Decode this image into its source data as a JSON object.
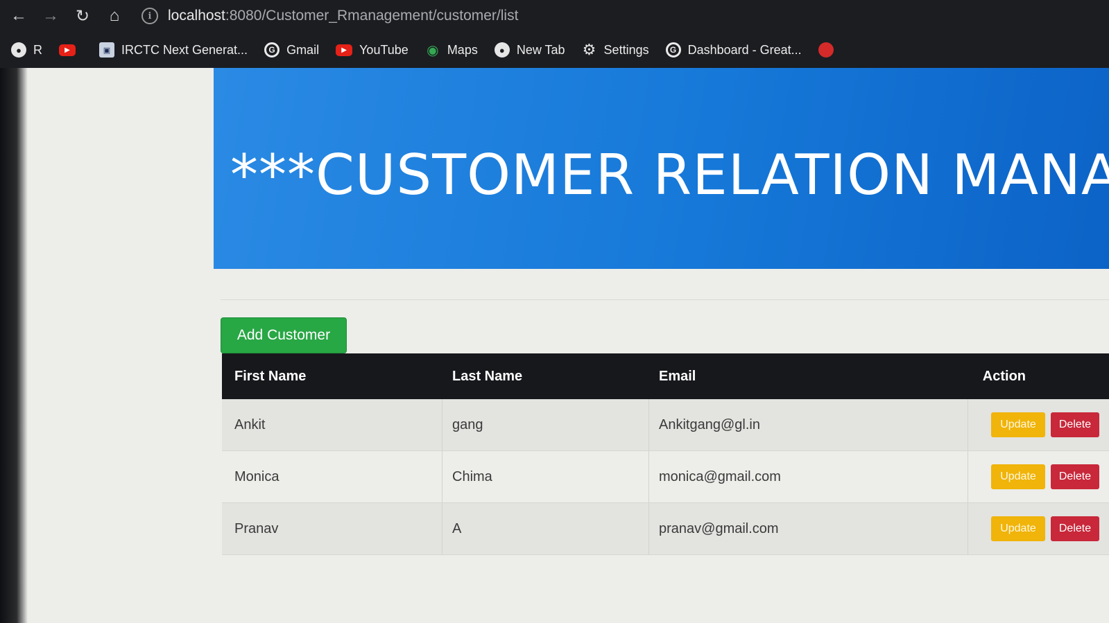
{
  "browser": {
    "url_host": "localhost",
    "url_path": ":8080/Customer_Rmanagement/customer/list",
    "bookmarks": [
      {
        "label": "R",
        "icon": "globe-icon"
      },
      {
        "label": "",
        "icon": "youtube-icon"
      },
      {
        "label": "IRCTC Next Generat...",
        "icon": "irctc-icon"
      },
      {
        "label": "Gmail",
        "icon": "google-icon"
      },
      {
        "label": "YouTube",
        "icon": "youtube-icon"
      },
      {
        "label": "Maps",
        "icon": "maps-pin-icon"
      },
      {
        "label": "New Tab",
        "icon": "globe-icon"
      },
      {
        "label": "Settings",
        "icon": "gear-icon"
      },
      {
        "label": "Dashboard - Great...",
        "icon": "google-icon"
      },
      {
        "label": "",
        "icon": "red-circle-icon"
      }
    ]
  },
  "header": {
    "title": "***CUSTOMER RELATION MANAGEME"
  },
  "toolbar": {
    "add_label": "Add Customer"
  },
  "table": {
    "columns": [
      "First Name",
      "Last Name",
      "Email",
      "Action"
    ],
    "rows": [
      {
        "first": "Ankit",
        "last": "gang",
        "email": "Ankitgang@gl.in"
      },
      {
        "first": "Monica",
        "last": "Chima",
        "email": "monica@gmail.com"
      },
      {
        "first": "Pranav",
        "last": "A",
        "email": "pranav@gmail.com"
      }
    ],
    "update_label": "Update",
    "delete_label": "Delete"
  },
  "colors": {
    "banner": "#1678d8",
    "add_button": "#28a745",
    "update_button": "#f0b40a",
    "delete_button": "#c8283a",
    "table_header": "#17181c"
  }
}
